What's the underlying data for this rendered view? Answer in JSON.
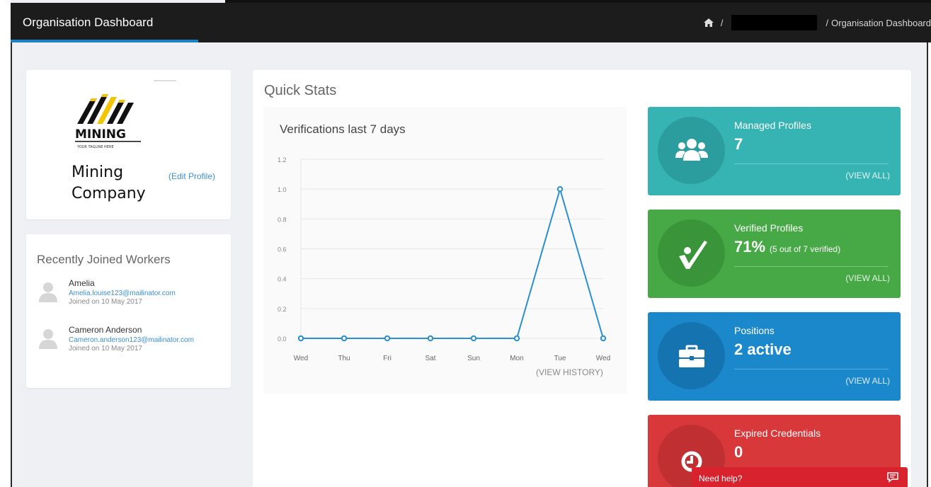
{
  "header": {
    "title": "Organisation Dashboard",
    "breadcrumb": {
      "separator": "/",
      "current": "Organisation Dashboard"
    }
  },
  "profile": {
    "company_name": "Mining Company",
    "edit_link": "(Edit Profile)",
    "logo": {
      "word": "MINING",
      "tagline": "YOUR TAGLINE HERE"
    }
  },
  "workers": {
    "title": "Recently Joined Workers",
    "items": [
      {
        "name": "Amelia",
        "email": "Amelia.louise123@mailinator.com",
        "joined": "Joined on 10 May 2017"
      },
      {
        "name": "Cameron Anderson",
        "email": "Cameron.anderson123@mailinator.com",
        "joined": "Joined on 10 May 2017"
      }
    ]
  },
  "quick_stats": {
    "title": "Quick Stats",
    "view_history": "(VIEW HISTORY)"
  },
  "chart_data": {
    "type": "line",
    "title": "Verifications last 7 days",
    "categories": [
      "Wed",
      "Thu",
      "Fri",
      "Sat",
      "Sun",
      "Mon",
      "Tue",
      "Wed"
    ],
    "values": [
      0,
      0,
      0,
      0,
      0,
      0,
      1,
      0
    ],
    "yticks": [
      "0.0",
      "0.2",
      "0.4",
      "0.6",
      "0.8",
      "1.0",
      "1.2"
    ],
    "ylim": [
      0,
      1.2
    ],
    "grid": true,
    "color": "#2a8fd0"
  },
  "tiles": {
    "managed": {
      "label": "Managed Profiles",
      "value": "7",
      "link": "(VIEW ALL)"
    },
    "verified": {
      "label": "Verified Profiles",
      "value": "71%",
      "note": "(5 out of 7 verified)",
      "link": "(VIEW ALL)"
    },
    "positions": {
      "label": "Positions",
      "value": "2 active",
      "link": "(VIEW ALL)"
    },
    "expired": {
      "label": "Expired Credentials",
      "value": "0"
    }
  },
  "help": {
    "label": "Need help?"
  },
  "colors": {
    "accent": "#1b82c5",
    "managed": "#36b3b3",
    "verified": "#46a946",
    "positions": "#1b88cc",
    "expired": "#d9383a",
    "help": "#d8232f"
  }
}
